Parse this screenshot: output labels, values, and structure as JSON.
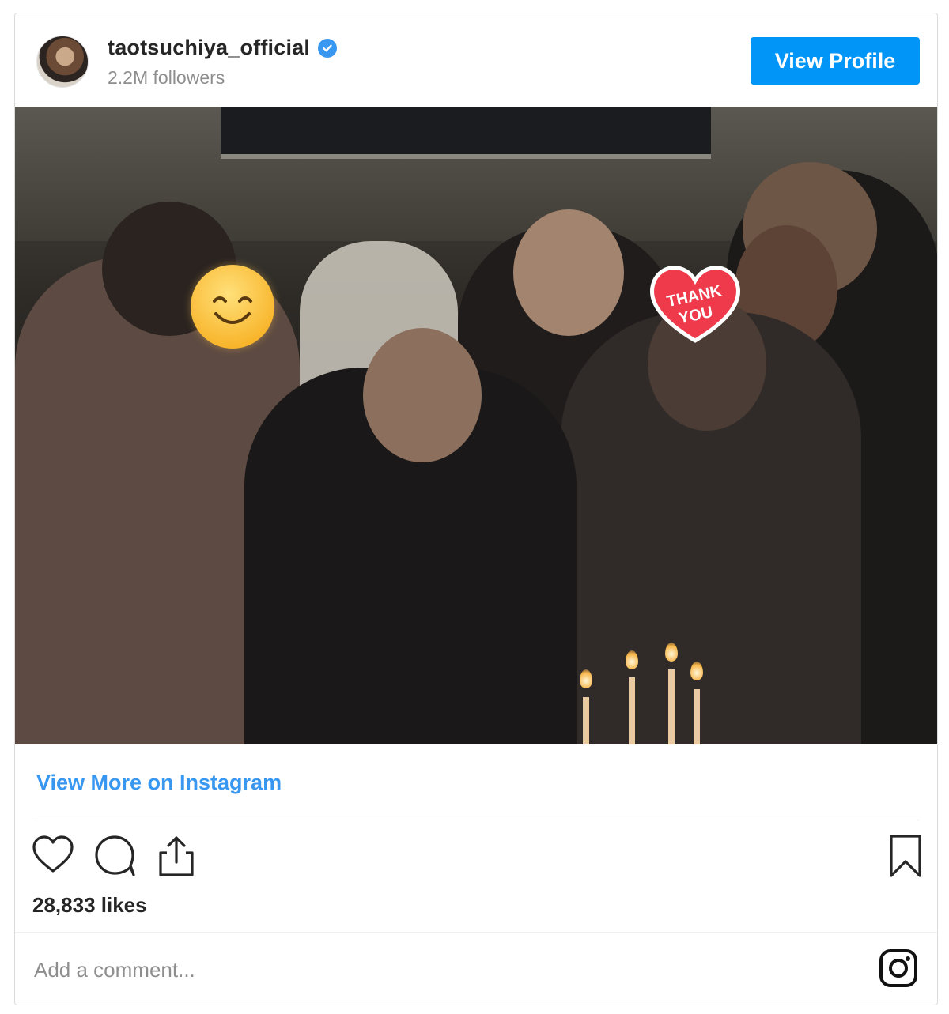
{
  "post": {
    "username": "taotsuchiya_official",
    "followers": "2.2M followers",
    "view_profile_label": "View Profile",
    "view_more_label": "View More on Instagram",
    "likes": "28,833 likes",
    "comment_placeholder": "Add a comment...",
    "sticker_text_line1": "THANK",
    "sticker_text_line2": "YOU"
  },
  "colors": {
    "accent": "#0095f6",
    "link": "#3897f0",
    "verified": "#3897f0",
    "text": "#262626",
    "muted": "#8e8e8e"
  },
  "icons": [
    "heart-icon",
    "comment-icon",
    "share-icon",
    "bookmark-icon",
    "instagram-icon",
    "verified-badge-icon"
  ]
}
